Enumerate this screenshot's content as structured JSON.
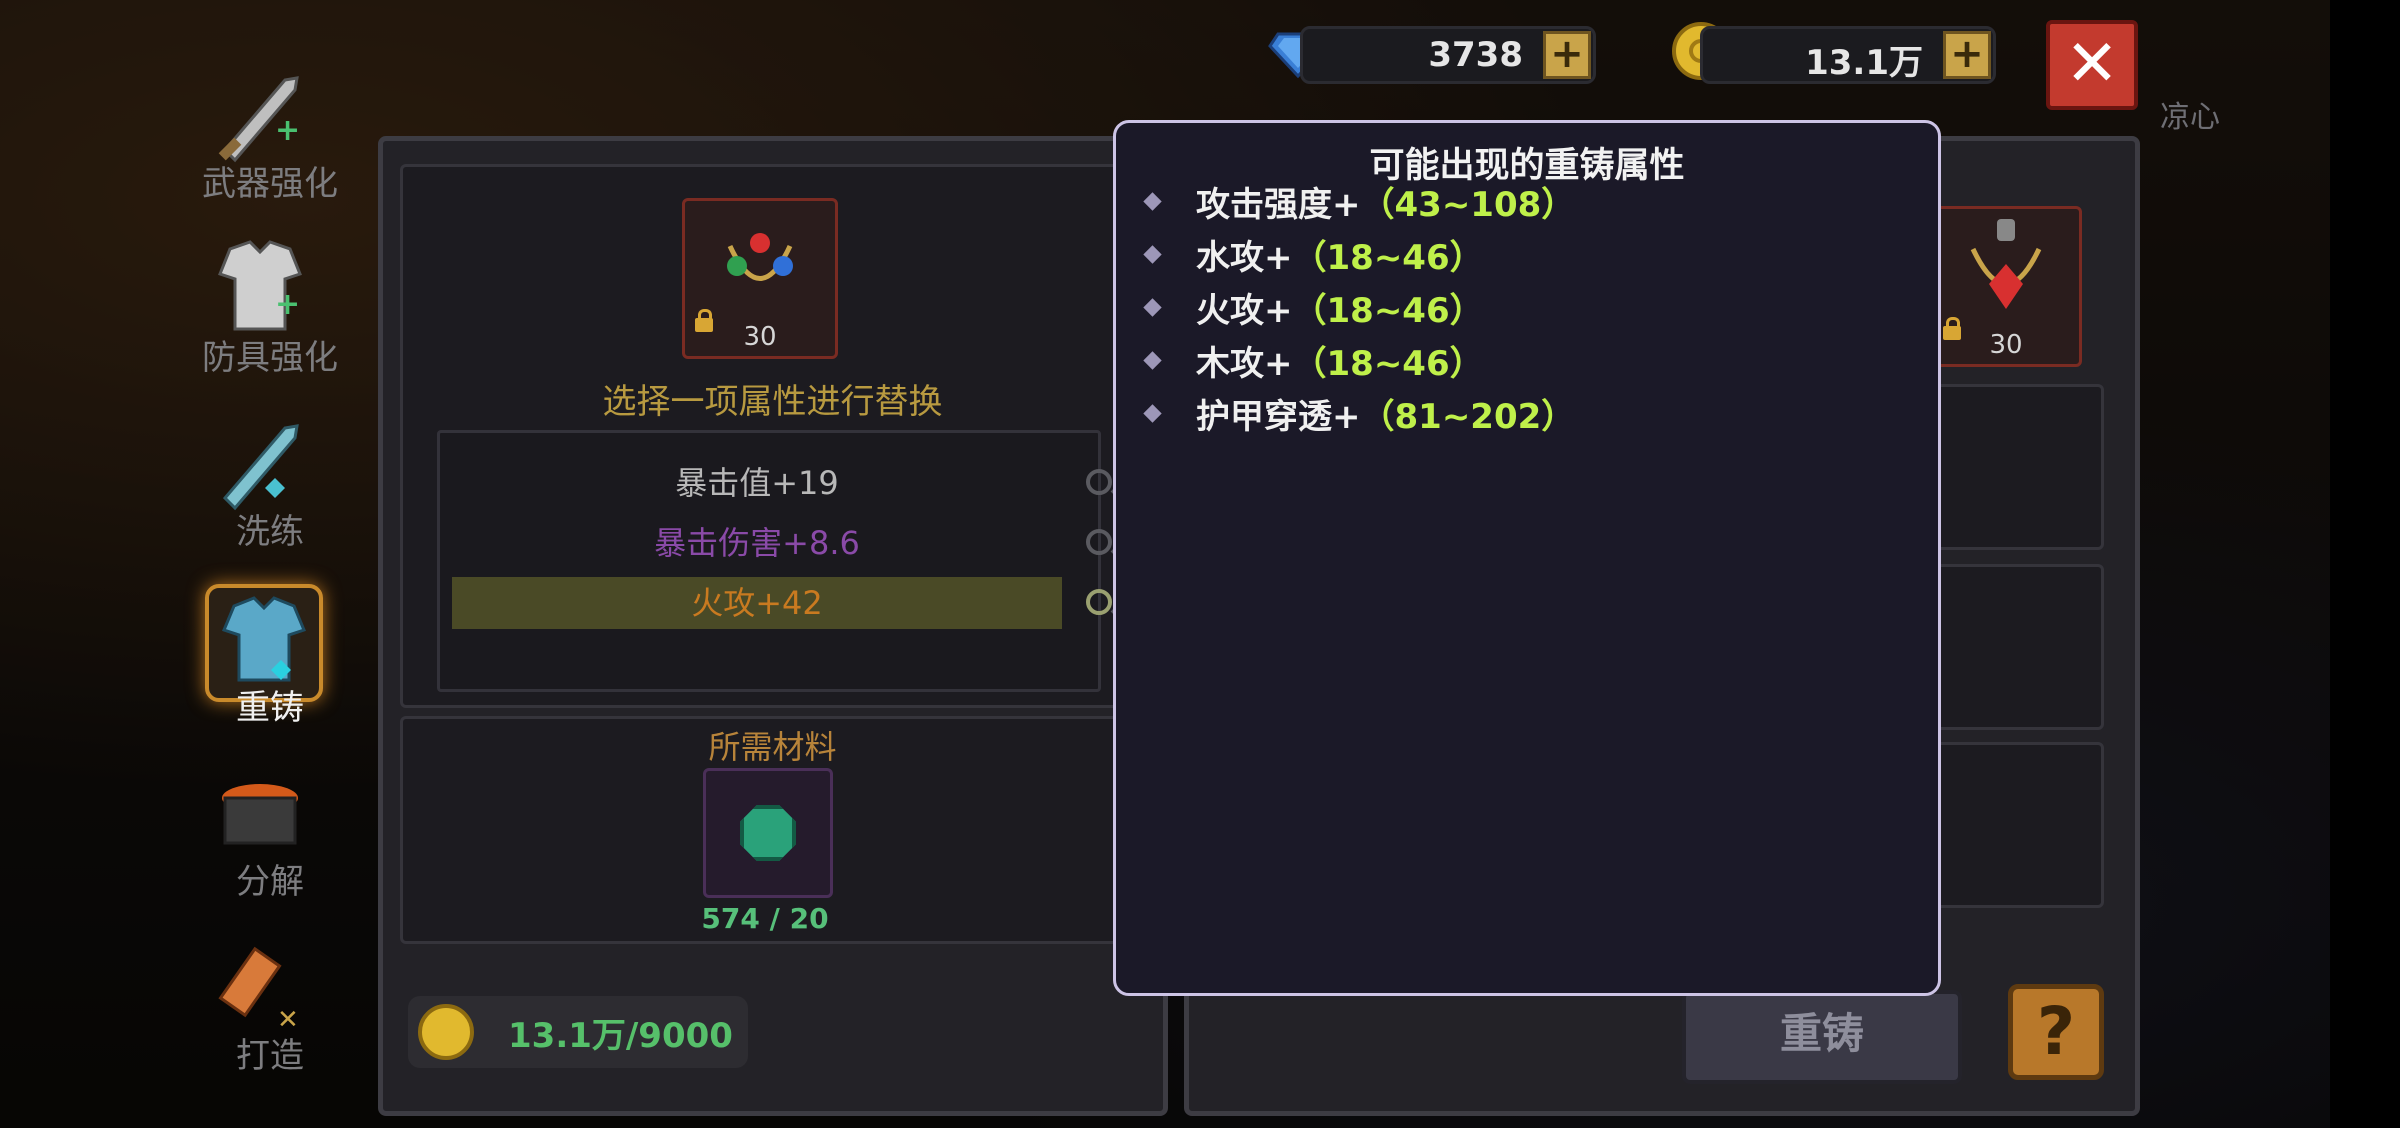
{
  "currency": {
    "gems": "3738",
    "gold": "13.1万",
    "add_label": "+"
  },
  "hero_name": "凉心",
  "close_label": "✕",
  "nav": [
    {
      "label": "武器强化",
      "icon": "sword-upgrade-icon"
    },
    {
      "label": "防具强化",
      "icon": "armor-upgrade-icon"
    },
    {
      "label": "洗练",
      "icon": "refine-icon"
    },
    {
      "label": "重铸",
      "icon": "reforge-icon",
      "active": true
    },
    {
      "label": "分解",
      "icon": "dismantle-icon"
    },
    {
      "label": "打造",
      "icon": "forge-icon"
    }
  ],
  "left_panel": {
    "item_level": "30",
    "select_prompt": "选择一项属性进行替换",
    "attributes": [
      {
        "text": "暴击值+19",
        "color": "#b8b8b8"
      },
      {
        "text": "暴击伤害+8.6",
        "color": "#8a4aa8"
      },
      {
        "text": "火攻+42",
        "color": "#c97a20",
        "selected": true
      }
    ],
    "materials_title": "所需材料",
    "material_count": "574 / 20",
    "cost": "13.1万/9000"
  },
  "right_panel": {
    "item_level": "30",
    "reforge_label": "重铸",
    "help_label": "?"
  },
  "tooltip": {
    "title": "可能出现的重铸属性",
    "items": [
      {
        "name": "攻击强度+",
        "range": "（43~108）"
      },
      {
        "name": "水攻+",
        "range": "（18~46）"
      },
      {
        "name": "火攻+",
        "range": "（18~46）"
      },
      {
        "name": "木攻+",
        "range": "（18~46）"
      },
      {
        "name": "护甲穿透+",
        "range": "（81~202）"
      }
    ]
  },
  "colors": {
    "accent_gold": "#c9a44a",
    "range_green": "#bff04a",
    "close_red": "#c33a2e"
  }
}
